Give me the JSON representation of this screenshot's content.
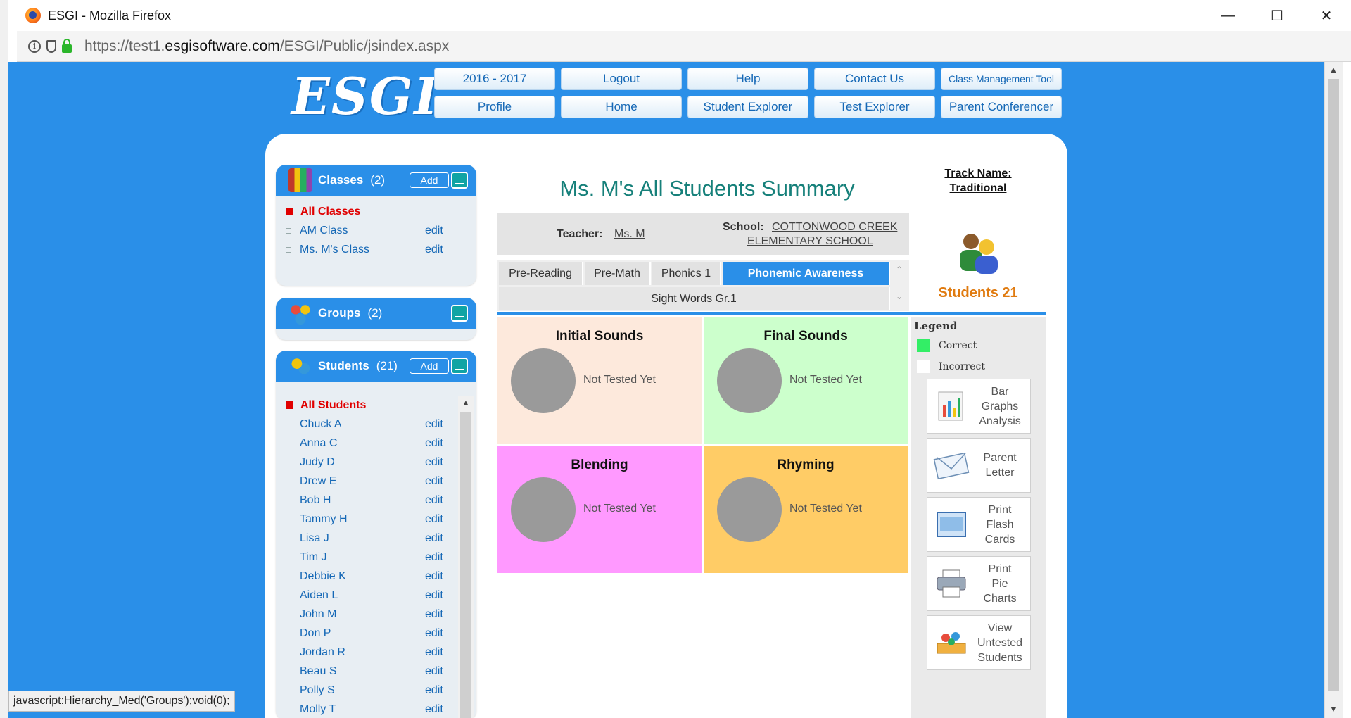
{
  "browser": {
    "title": "ESGI - Mozilla Firefox",
    "url_prefix": "https://test1.",
    "url_domain": "esgisoftware.com",
    "url_path": "/ESGI/Public/jsindex.aspx",
    "status_text": "javascript:Hierarchy_Med('Groups');void(0);"
  },
  "logo": "ESGI",
  "nav": {
    "row1": [
      "2016 - 2017",
      "Logout",
      "Help",
      "Contact Us",
      "Class Management Tool"
    ],
    "row2": [
      "Profile",
      "Home",
      "Student Explorer",
      "Test Explorer",
      "Parent Conferencer"
    ]
  },
  "classes": {
    "title": "Classes",
    "count": "(2)",
    "add_label": "Add",
    "all_label": "All Classes",
    "items": [
      {
        "name": "AM Class",
        "edit": "edit"
      },
      {
        "name": "Ms. M's Class",
        "edit": "edit"
      }
    ]
  },
  "groups": {
    "title": "Groups",
    "count": "(2)"
  },
  "students": {
    "title": "Students",
    "count": "(21)",
    "add_label": "Add",
    "all_label": "All Students",
    "items": [
      {
        "name": "Chuck A",
        "edit": "edit"
      },
      {
        "name": "Anna C",
        "edit": "edit"
      },
      {
        "name": "Judy D",
        "edit": "edit"
      },
      {
        "name": "Drew E",
        "edit": "edit"
      },
      {
        "name": "Bob H",
        "edit": "edit"
      },
      {
        "name": "Tammy H",
        "edit": "edit"
      },
      {
        "name": "Lisa J",
        "edit": "edit"
      },
      {
        "name": "Tim J",
        "edit": "edit"
      },
      {
        "name": "Debbie K",
        "edit": "edit"
      },
      {
        "name": "Aiden L",
        "edit": "edit"
      },
      {
        "name": "John M",
        "edit": "edit"
      },
      {
        "name": "Don P",
        "edit": "edit"
      },
      {
        "name": "Jordan R",
        "edit": "edit"
      },
      {
        "name": "Beau S",
        "edit": "edit"
      },
      {
        "name": "Polly S",
        "edit": "edit"
      },
      {
        "name": "Molly T",
        "edit": "edit"
      }
    ]
  },
  "summary": {
    "title": "Ms. M's All Students Summary",
    "teacher_label": "Teacher:",
    "teacher_name": "Ms. M",
    "school_label": "School:",
    "school_line1": "COTTONWOOD CREEK",
    "school_line2": "ELEMENTARY SCHOOL"
  },
  "tabs": [
    "Pre-Reading",
    "Pre-Math",
    "Phonics 1",
    "Phonemic Awareness",
    "Sight Words Gr.1"
  ],
  "active_tab": "Phonemic Awareness",
  "cells": [
    {
      "title": "Initial Sounds",
      "status": "Not Tested Yet",
      "color": "#fde9dc"
    },
    {
      "title": "Final Sounds",
      "status": "Not Tested Yet",
      "color": "#ccffcc"
    },
    {
      "title": "Blending",
      "status": "Not Tested Yet",
      "color": "#ff99ff"
    },
    {
      "title": "Rhyming",
      "status": "Not Tested Yet",
      "color": "#ffcc66"
    }
  ],
  "track": {
    "line1": "Track Name:",
    "line2": "Traditional"
  },
  "students_total": "Students 21",
  "legend": {
    "title": "Legend",
    "correct": "Correct",
    "incorrect": "Incorrect",
    "correct_color": "#33ee66",
    "incorrect_color": "#ffffff"
  },
  "tools": [
    {
      "label_lines": [
        "Bar",
        "Graphs",
        "Analysis"
      ],
      "icon": "bar-graph-icon"
    },
    {
      "label_lines": [
        "Parent",
        "Letter"
      ],
      "icon": "envelope-icon"
    },
    {
      "label_lines": [
        "Print",
        "Flash",
        "Cards"
      ],
      "icon": "flash-card-icon"
    },
    {
      "label_lines": [
        "Print",
        "Pie",
        "Charts"
      ],
      "icon": "printer-icon"
    },
    {
      "label_lines": [
        "View",
        "Untested",
        "Students"
      ],
      "icon": "untested-students-icon"
    }
  ],
  "colors": {
    "page_blue": "#2a8fe8",
    "accent_teal": "#16807a",
    "active_red": "#e00000",
    "students_orange": "#e07b10"
  }
}
